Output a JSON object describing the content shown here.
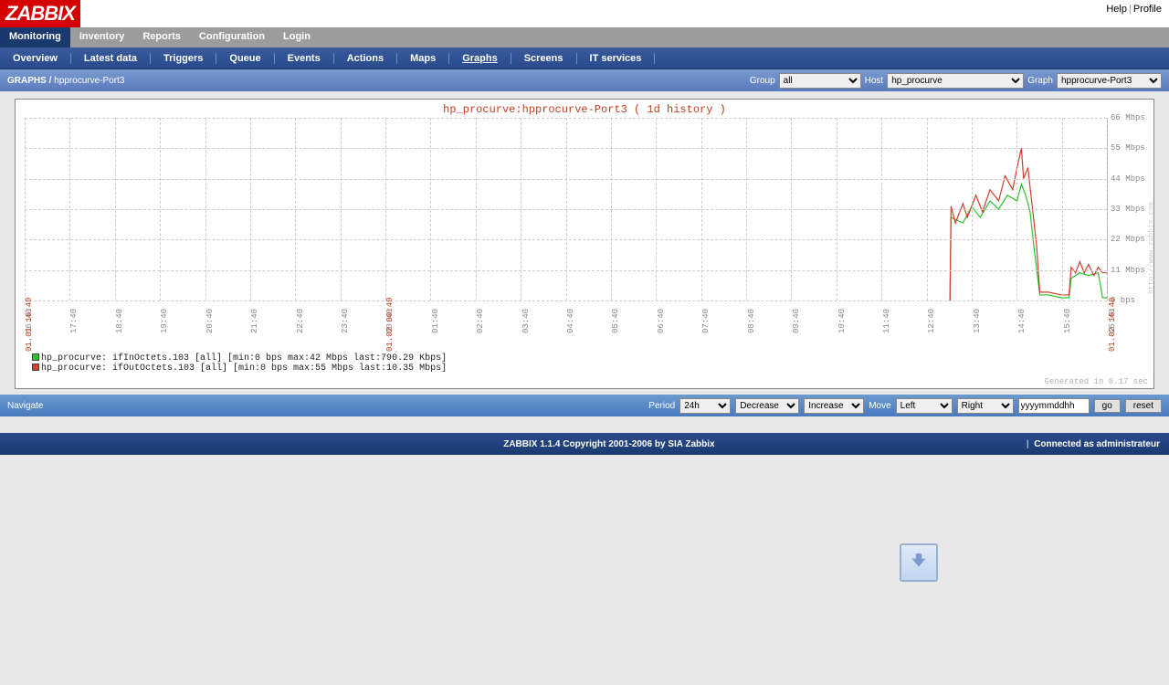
{
  "top_links": {
    "help": "Help",
    "profile": "Profile"
  },
  "logo": "ZABBIX",
  "main_nav": [
    "Monitoring",
    "Inventory",
    "Reports",
    "Configuration",
    "Login"
  ],
  "sub_nav": [
    "Overview",
    "Latest data",
    "Triggers",
    "Queue",
    "Events",
    "Actions",
    "Maps",
    "Graphs",
    "Screens",
    "IT services"
  ],
  "sub_nav_active": "Graphs",
  "crumb": {
    "section": "GRAPHS",
    "sep": "/",
    "current": "hpprocurve-Port3"
  },
  "filters": {
    "group_label": "Group",
    "group_value": "all",
    "host_label": "Host",
    "host_value": "hp_procurve",
    "graph_label": "Graph",
    "graph_value": "hpprocurve-Port3"
  },
  "chart_title": "hp_procurve:hpprocurve-Port3 ( 1d history )",
  "gen_note": "Generated in 0.17 sec",
  "legend": {
    "a": "hp_procurve: ifInOctets.103  [all] [min:0 bps max:42 Mbps last:790.29 Kbps]",
    "b": "hp_procurve: ifOutOctets.103 [all] [min:0 bps max:55 Mbps last:10.35 Mbps]",
    "color_a": "#30c030",
    "color_b": "#d04030"
  },
  "navbar": {
    "label": "Navigate",
    "period_label": "Period",
    "period_value": "24h",
    "decrease": "Decrease",
    "increase": "Increase",
    "move_label": "Move",
    "move_left": "Left",
    "move_right": "Right",
    "stamp": "yyyymmddhh",
    "go": "go",
    "reset": "reset"
  },
  "footer": {
    "copy": "ZABBIX 1.1.4 Copyright 2001-2006 by SIA Zabbix",
    "conn": "Connected as administrateur"
  },
  "sidemark": "http://www.zabbix.com",
  "chart_data": {
    "type": "line",
    "title": "hp_procurve:hpprocurve-Port3 ( 1d history )",
    "xlabel": "",
    "ylabel": "",
    "ylim": [
      0,
      66
    ],
    "y_ticks": [
      0,
      11,
      22,
      33,
      44,
      55,
      66
    ],
    "y_tick_labels": [
      "0 bps",
      "11 Mbps",
      "22 Mbps",
      "33 Mbps",
      "44 Mbps",
      "55 Mbps",
      "66 Mbps"
    ],
    "x_ticks": [
      "16:40",
      "17:40",
      "18:40",
      "19:40",
      "20:40",
      "21:40",
      "22:40",
      "23:40",
      "00:40",
      "01:40",
      "02:40",
      "03:40",
      "04:40",
      "05:40",
      "06:40",
      "07:40",
      "08:40",
      "09:40",
      "10:40",
      "11:40",
      "12:40",
      "13:40",
      "14:40",
      "15:40",
      "16:40"
    ],
    "x_markers": [
      {
        "pos": 0.0,
        "label": "01.01 16:40",
        "red": true
      },
      {
        "pos": 0.333,
        "label": "01.02 00:40",
        "red": true
      },
      {
        "pos": 1.0,
        "label": "01.02 16:40",
        "red": true
      }
    ],
    "series": [
      {
        "name": "ifInOctets.103",
        "color": "#30c030",
        "min": "0 bps",
        "max": "42 Mbps",
        "last": "790.29 Kbps",
        "points": [
          [
            0.855,
            0
          ],
          [
            0.856,
            30
          ],
          [
            0.867,
            28
          ],
          [
            0.875,
            34
          ],
          [
            0.883,
            30
          ],
          [
            0.892,
            36
          ],
          [
            0.9,
            33
          ],
          [
            0.908,
            38
          ],
          [
            0.917,
            36
          ],
          [
            0.921,
            42
          ],
          [
            0.925,
            38
          ],
          [
            0.929,
            32
          ],
          [
            0.933,
            18
          ],
          [
            0.938,
            2
          ],
          [
            0.946,
            2
          ],
          [
            0.958,
            1
          ],
          [
            0.965,
            1
          ],
          [
            0.967,
            8
          ],
          [
            0.975,
            10
          ],
          [
            0.983,
            9
          ],
          [
            0.992,
            10
          ],
          [
            0.996,
            1
          ],
          [
            1.0,
            1
          ]
        ]
      },
      {
        "name": "ifOutOctets.103",
        "color": "#d04030",
        "min": "0 bps",
        "max": "55 Mbps",
        "last": "10.35 Mbps",
        "points": [
          [
            0.855,
            0
          ],
          [
            0.856,
            34
          ],
          [
            0.86,
            28
          ],
          [
            0.867,
            35
          ],
          [
            0.871,
            30
          ],
          [
            0.879,
            38
          ],
          [
            0.885,
            32
          ],
          [
            0.892,
            40
          ],
          [
            0.9,
            36
          ],
          [
            0.906,
            45
          ],
          [
            0.913,
            40
          ],
          [
            0.917,
            48
          ],
          [
            0.921,
            55
          ],
          [
            0.923,
            44
          ],
          [
            0.927,
            48
          ],
          [
            0.931,
            34
          ],
          [
            0.935,
            20
          ],
          [
            0.938,
            3
          ],
          [
            0.946,
            3
          ],
          [
            0.958,
            2
          ],
          [
            0.965,
            2
          ],
          [
            0.967,
            12
          ],
          [
            0.971,
            10
          ],
          [
            0.975,
            14
          ],
          [
            0.979,
            10
          ],
          [
            0.983,
            13
          ],
          [
            0.988,
            9
          ],
          [
            0.992,
            12
          ],
          [
            0.996,
            10
          ],
          [
            1.0,
            10
          ]
        ]
      }
    ]
  }
}
